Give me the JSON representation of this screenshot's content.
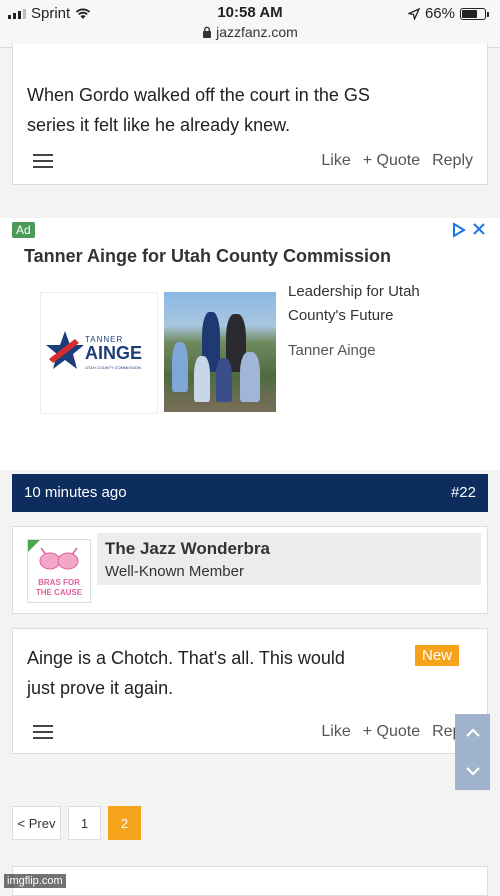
{
  "status_bar": {
    "carrier": "Sprint",
    "time": "10:58 AM",
    "url": "jazzfanz.com",
    "battery": "66%",
    "battery_level": 0.66
  },
  "post_prev": {
    "text_line1": "When Gordo walked off the court in the GS",
    "text_line2": "series it felt like he already knew.",
    "like": "Like",
    "quote": "+ Quote",
    "reply": "Reply"
  },
  "ad": {
    "badge": "Ad",
    "title": "Tanner Ainge for Utah County Commission",
    "logo_top": "TANNER",
    "logo_name": "AINGE",
    "logo_sub": "UTAH COUNTY COMMISSION",
    "desc_line1": "Leadership for Utah",
    "desc_line2": "County's Future",
    "advertiser": "Tanner Ainge"
  },
  "post_header": {
    "time": "10 minutes ago",
    "number": "#22"
  },
  "user": {
    "name": "The Jazz Wonderbra",
    "title": "Well-Known Member",
    "avatar_line1": "BRAS FOR",
    "avatar_line2": "THE CAUSE"
  },
  "post": {
    "text_line1": "Ainge is a Chotch. That's all. This would",
    "text_line2": "just prove it again.",
    "badge": "New",
    "like": "Like",
    "quote": "+ Quote",
    "reply": "Reply"
  },
  "pagination": {
    "prev": "< Prev",
    "page1": "1",
    "page2": "2",
    "current": "2"
  },
  "watermark": "imgflip.com",
  "colors": {
    "navbar": "#0c2d5e",
    "accent_orange": "#f5a31a",
    "ad_badge": "#4c9a57"
  }
}
